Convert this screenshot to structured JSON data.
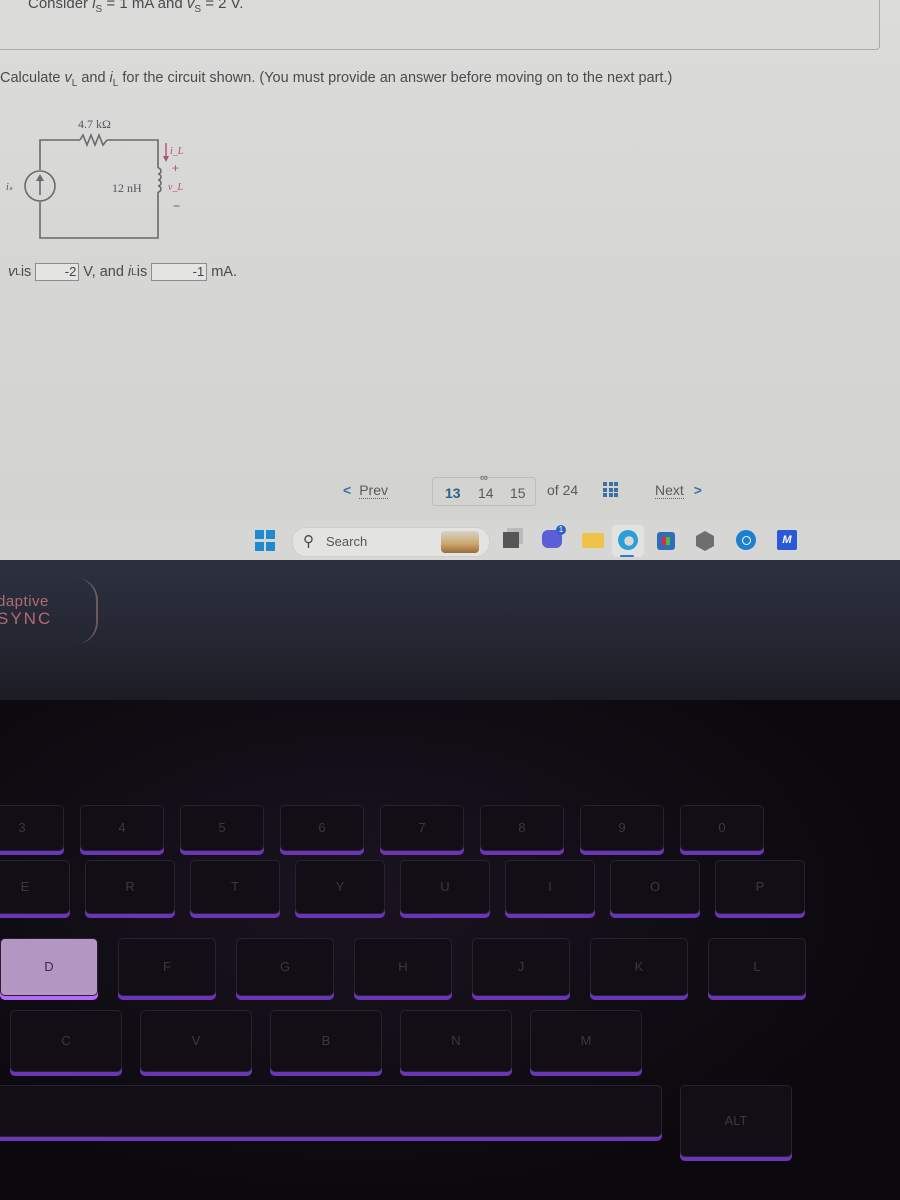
{
  "question": {
    "context": {
      "prefix": "Consider ",
      "is_var": "i",
      "is_sub": "S",
      "is_value": " = 1 mA and ",
      "vs_var": "v",
      "vs_sub": "S",
      "vs_value": " = 2 V."
    },
    "prompt": {
      "prefix": "Calculate ",
      "vl_var": "v",
      "vl_sub": "L",
      "mid": " and ",
      "il_var": "i",
      "il_sub": "L",
      "suffix": " for the circuit shown. (You must provide an answer before moving on to the next part.)"
    },
    "circuit": {
      "resistor_label": "4.7 kΩ",
      "inductor_label": "12 nH",
      "source_label": "iₛ",
      "current_label": "i_L",
      "voltage_label": "v_L",
      "plus": "+",
      "minus": "−"
    },
    "answer": {
      "vl_var": "v",
      "vl_sub": "L",
      "is_word": " is",
      "vl_value": "-2",
      "vl_unit": "V, and ",
      "il_var": "i",
      "il_sub": "L",
      "il_is_word": " is",
      "il_value": "-1",
      "il_unit": "mA."
    }
  },
  "navigation": {
    "prev_label": "Prev",
    "pages": [
      "13",
      "14",
      "15"
    ],
    "active_page": "13",
    "of_label": "of 24",
    "next_label": "Next",
    "link_icon": "link-icon",
    "grid_icon": "grid-icon"
  },
  "taskbar": {
    "search_placeholder": "Search",
    "chat_badge": "1",
    "app_m_label": "M",
    "icons": [
      "windows-start-icon",
      "search-icon",
      "task-view-icon",
      "chat-icon",
      "file-explorer-icon",
      "edge-icon",
      "store-icon",
      "gem-app-icon",
      "copilot-icon",
      "m-app-icon"
    ]
  },
  "bezel": {
    "brand_line1": "daptive",
    "brand_line2": "SYNC"
  },
  "keyboard": {
    "row_numbers": [
      "3",
      "4",
      "5",
      "6",
      "7",
      "8",
      "9",
      "0"
    ],
    "row_top": [
      "E",
      "R",
      "T",
      "Y",
      "U",
      "I",
      "O",
      "P"
    ],
    "row_home": [
      "D",
      "F",
      "G",
      "H",
      "J",
      "K",
      "L"
    ],
    "row_bottom": [
      "C",
      "V",
      "B",
      "N",
      "M"
    ],
    "alt_label": "ALT"
  }
}
